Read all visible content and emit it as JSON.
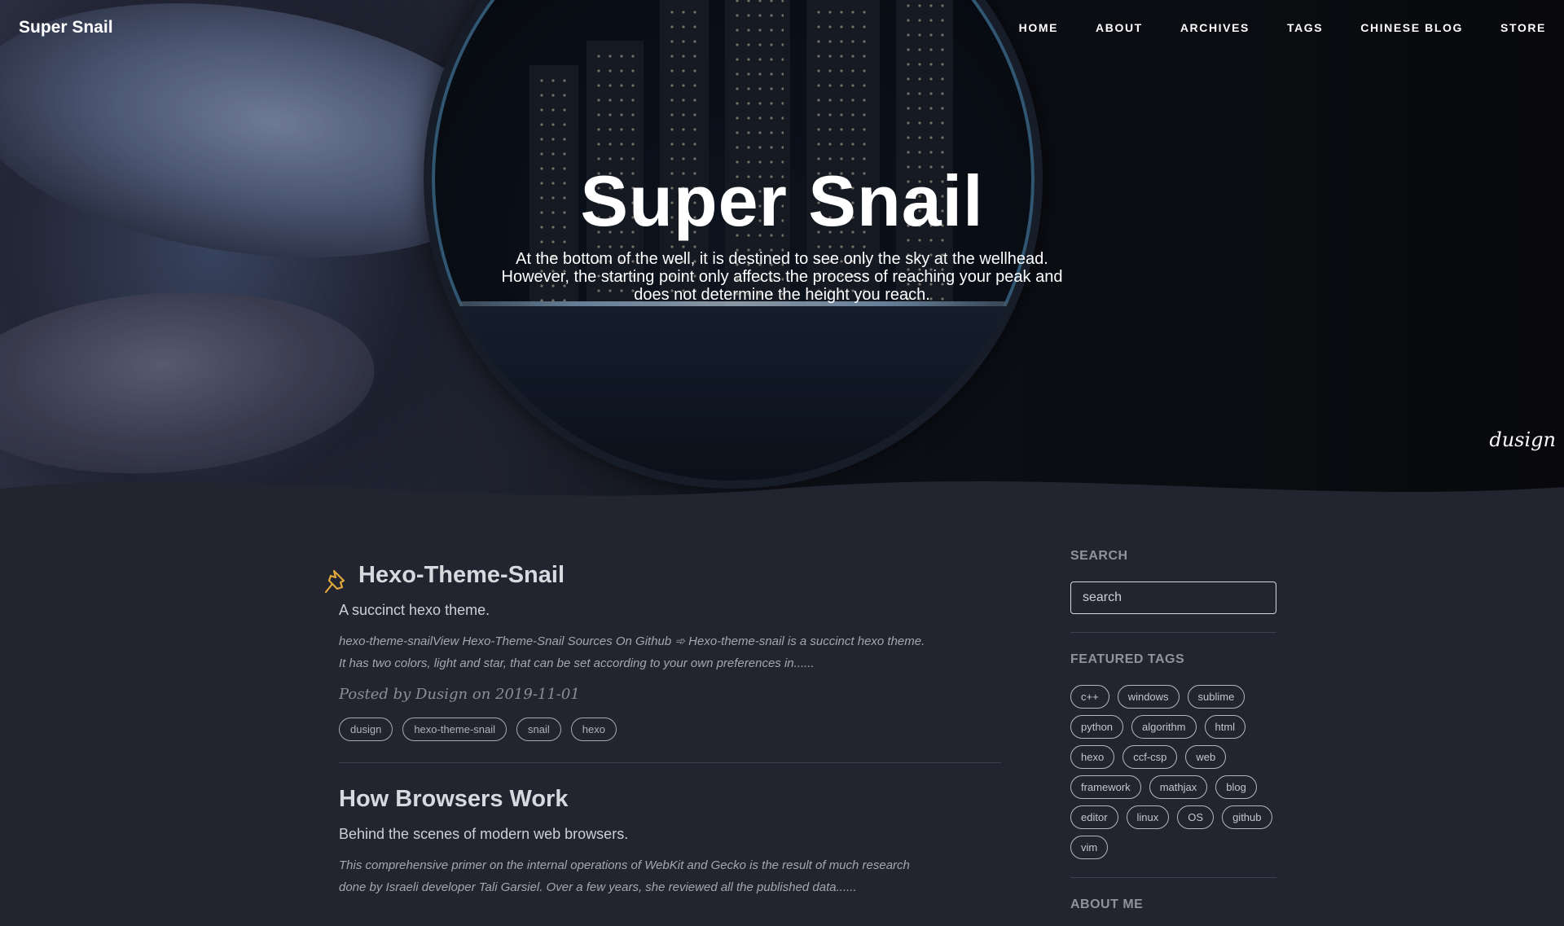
{
  "site": {
    "brand": "Super Snail"
  },
  "nav": {
    "items": [
      "HOME",
      "ABOUT",
      "ARCHIVES",
      "TAGS",
      "CHINESE BLOG",
      "STORE"
    ]
  },
  "hero": {
    "title": "Super Snail",
    "subtitle_lines": [
      "At the bottom of the well, it is destined to see only the sky at the wellhead.",
      "However, the starting point only affects the process of reaching your peak and",
      "does not determine the height you reach."
    ],
    "signature": "dusign"
  },
  "posts": [
    {
      "title": "Hexo-Theme-Snail",
      "pinned": true,
      "subtitle": "A succinct hexo theme.",
      "excerpt_lines": [
        "hexo-theme-snailView Hexo-Theme-Snail Sources On Github ➾ Hexo-theme-snail is a succinct hexo theme.",
        "It has two colors, light and star, that can be set according to your own preferences in......"
      ],
      "meta": "Posted by Dusign on 2019-11-01",
      "tags": [
        "dusign",
        "hexo-theme-snail",
        "snail",
        "hexo"
      ]
    },
    {
      "title": "How Browsers Work",
      "pinned": false,
      "subtitle": "Behind the scenes of modern web browsers.",
      "excerpt_lines": [
        "This comprehensive primer on the internal operations of WebKit and Gecko is the result of much research",
        "done by Israeli developer Tali Garsiel. Over a few years, she reviewed all the published data......"
      ]
    }
  ],
  "sidebar": {
    "search_heading": "SEARCH",
    "search_placeholder": "search",
    "tags_heading": "FEATURED TAGS",
    "tags": [
      "c++",
      "windows",
      "sublime",
      "python",
      "algorithm",
      "html",
      "hexo",
      "ccf-csp",
      "web",
      "framework",
      "mathjax",
      "blog",
      "editor",
      "linux",
      "OS",
      "github",
      "vim"
    ],
    "about_heading": "ABOUT ME"
  },
  "colors": {
    "background": "#22242f",
    "pin_accent": "#e0a73a"
  }
}
